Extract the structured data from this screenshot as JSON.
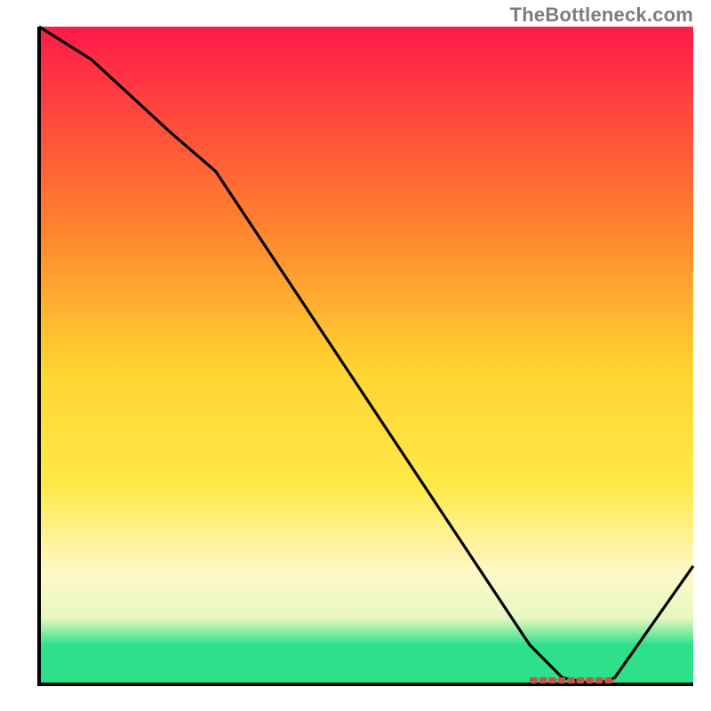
{
  "watermark": "TheBottleneck.com",
  "colors": {
    "gradient_top": "#ff1a4a",
    "gradient_mid1": "#ff7a2f",
    "gradient_mid2": "#ffd430",
    "gradient_yellow": "#ffe94a",
    "gradient_cream": "#fff8c8",
    "gradient_pale": "#e6f7c0",
    "gradient_green": "#2fe08a",
    "axis": "#000000",
    "curve": "#000000",
    "marker": "#c0564b"
  },
  "chart_data": {
    "type": "line",
    "title": "",
    "xlabel": "",
    "ylabel": "",
    "xlim": [
      0,
      100
    ],
    "ylim": [
      0,
      100
    ],
    "x": [
      0,
      8,
      20,
      27,
      75,
      80,
      85,
      88,
      100
    ],
    "values": [
      100,
      95,
      84,
      78,
      6,
      1,
      0,
      1,
      18
    ],
    "optimum_band": {
      "x_start": 75,
      "x_end": 88,
      "y": 0.6
    },
    "gradient_stops_pct": [
      0,
      28,
      52,
      70,
      83,
      90,
      94,
      100
    ]
  }
}
